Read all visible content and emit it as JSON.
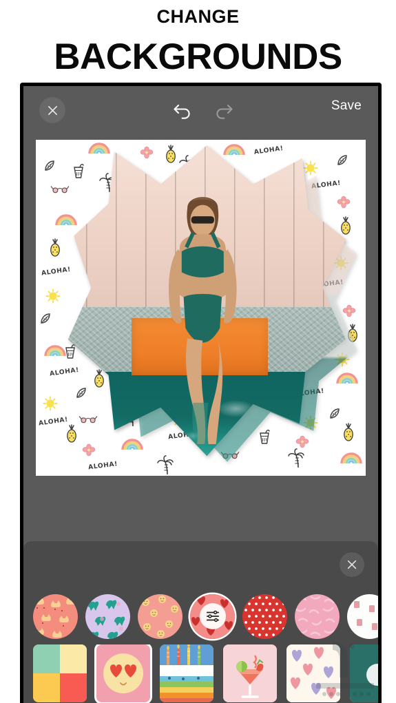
{
  "headline": {
    "line1": "CHANGE",
    "line2": "BACKGROUNDS"
  },
  "toolbar": {
    "close_label": "close-icon",
    "undo_label": "undo-icon",
    "redo_label": "redo-icon",
    "save_label": "Save",
    "undo_state": "enabled",
    "redo_state": "disabled"
  },
  "canvas": {
    "background_style": "tropical doodle pattern on white",
    "doodle_text": "ALOHA!",
    "doodle_motifs": [
      "aloha-text",
      "rainbow",
      "pineapple",
      "palm-tree",
      "sunglasses",
      "cocktail-drink",
      "sun",
      "flower",
      "leaf"
    ],
    "cutout_shape": "star-burst",
    "photo_subject": "woman in teal bikini sitting on orange towel by pool",
    "photo_elements": [
      "wooden-deck",
      "stone-ledge",
      "orange-towel",
      "pool-water"
    ]
  },
  "sticker_panel": {
    "close_label": "close-icon",
    "categories": [
      {
        "name": "cats",
        "base": "#f58d7f",
        "motif": "#f7c98a",
        "selected": false
      },
      {
        "name": "dinosaurs",
        "base": "#d9c6ec",
        "motif": "#23a08f",
        "selected": false
      },
      {
        "name": "smileys",
        "base": "#f49e93",
        "motif": "#f6d58a",
        "selected": false
      },
      {
        "name": "adjust",
        "base": "#f48d8a",
        "motif": "#c9302c",
        "selected": true,
        "icon": "sliders-icon"
      },
      {
        "name": "dots",
        "base": "#d8352f",
        "motif": "#ffffff",
        "selected": false
      },
      {
        "name": "texture",
        "base": "#f2a8bd",
        "motif": "#f6c4d4",
        "selected": false
      },
      {
        "name": "white-cards",
        "base": "#fdfdfb",
        "motif": "#e2a0a6",
        "selected": false
      }
    ],
    "thumbnails": [
      {
        "name": "color-grid",
        "selected": false,
        "colors": [
          "#8fd0b3",
          "#fbeaa7",
          "#fcc951",
          "#f75b52"
        ]
      },
      {
        "name": "heart-eyes-emoji",
        "selected": true,
        "colors": [
          "#f3a0ae",
          "#f8e2a4",
          "#e84b3c"
        ]
      },
      {
        "name": "birthday-cake",
        "selected": false,
        "colors": [
          "#5f9fd6",
          "#ffffff",
          "#f0932b",
          "#6ab04c"
        ]
      },
      {
        "name": "cocktail-glass",
        "selected": false,
        "colors": [
          "#f6d4d8",
          "#f0745d",
          "#8ac24a"
        ]
      },
      {
        "name": "hearts-pattern",
        "selected": false,
        "colors": [
          "#fdf7ee",
          "#e87f8c",
          "#9b8fd0"
        ]
      },
      {
        "name": "teal-card",
        "selected": false,
        "colors": [
          "#2a6f68",
          "#ffffff"
        ]
      }
    ]
  },
  "colors": {
    "frame": "#000000",
    "chrome": "#5a5a5a",
    "panel": "#4a4a4a",
    "accent_white": "#ffffff",
    "headline": "#0a0a0a"
  }
}
